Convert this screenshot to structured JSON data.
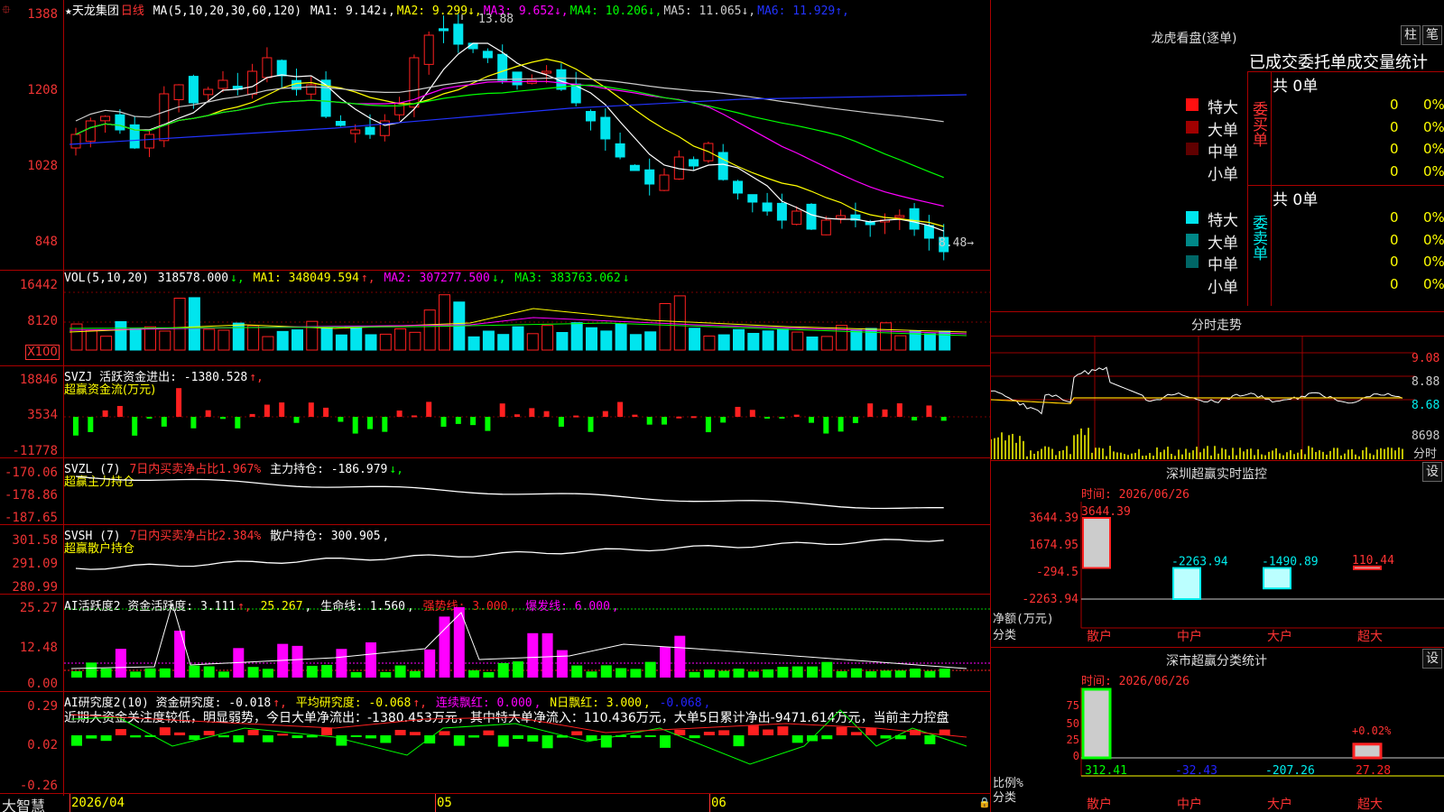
{
  "colors": {
    "up": "#ff2020",
    "down": "#00e5ee",
    "grid": "#9a0000",
    "label": "#ff3333"
  },
  "main": {
    "stock_name": "★天龙集团",
    "period": "日线",
    "ma_header": "MA(5,10,20,30,60,120)",
    "ma_values": [
      {
        "label": "MA1:",
        "value": "9.142",
        "arrow": "↓",
        "color": "#ffffff"
      },
      {
        "label": "MA2:",
        "value": "9.299",
        "arrow": "↓",
        "color": "#ffff00"
      },
      {
        "label": "MA3:",
        "value": "9.652",
        "arrow": "↓",
        "color": "#ff00ff"
      },
      {
        "label": "MA4:",
        "value": "10.206",
        "arrow": "↓",
        "color": "#00ff00"
      },
      {
        "label": "MA5:",
        "value": "11.065",
        "arrow": "↓",
        "color": "#cccccc"
      },
      {
        "label": "MA6:",
        "value": "11.929",
        "arrow": "↑",
        "color": "#2233ff"
      }
    ],
    "y_ticks": [
      "1388",
      "1208",
      "1028",
      "848"
    ],
    "high_mark": "13.88",
    "low_mark": "8.48→"
  },
  "vol": {
    "header": "VOL(5,10,20)",
    "value": "318578.000",
    "ma1": "MA1: 348049.594",
    "ma2": "MA2: 307277.500",
    "ma3": "MA3: 383763.062",
    "y_ticks": [
      "16442",
      "8120"
    ],
    "unit": "X100"
  },
  "svzj": {
    "header": "SVZJ  活跃资金进出: -1380.528",
    "title": "超赢资金流(万元)",
    "y_ticks": [
      "18846",
      "3534",
      "-11778"
    ]
  },
  "svzl": {
    "header1": "SVZL (7)",
    "header2": "7日内买卖净占比1.967%",
    "header3": "主力持仓: -186.979",
    "title": "超赢主力持仓",
    "y_ticks": [
      "-170.06",
      "-178.86",
      "-187.65"
    ]
  },
  "svsh": {
    "header1": "SVSH (7)",
    "header2": "7日内买卖净占比2.384%",
    "header3": "散户持仓: 300.905",
    "title": "超赢散户持仓",
    "y_ticks": [
      "301.58",
      "291.09",
      "280.99"
    ]
  },
  "ai1": {
    "header1": "AI活跃度2 资金活跃度: 3.111",
    "header2": "25.267",
    "header3": "生命线: 1.560",
    "header4": "强势线: 3.000",
    "header5": "爆发线: 6.000",
    "y_ticks": [
      "25.27",
      "12.48",
      "0.00"
    ]
  },
  "ai2": {
    "header1": "AI研究度2(10) 资金研究度: -0.018",
    "header2": "平均研究度: -0.068",
    "header3": "连续飘红: 0.000",
    "header4": "N日飘红: 3.000",
    "header5": "-0.068",
    "commentary": "近期大资金关注度较低，明显弱势，今日大单净流出：-1380.453万元，其中特大单净流入：110.436万元，大单5日累计净出-9471.614万元，当前主力控盘",
    "y_ticks": [
      "0.29",
      "0.02",
      "-0.26"
    ]
  },
  "xaxis": {
    "dates": [
      "2026/04",
      "05",
      "06"
    ],
    "brand": "大智慧"
  },
  "lhb": {
    "title": "龙虎看盘(逐单)",
    "btn_bar": "柱",
    "btn_pen": "笔",
    "subtitle": "已成交委托单成交量统计",
    "buy": {
      "side": "委买单",
      "total": "共 0单",
      "rows": [
        {
          "label": "特大",
          "value": "0",
          "pct": "0%",
          "color": "#ff1010"
        },
        {
          "label": "大单",
          "value": "0",
          "pct": "0%",
          "color": "#a00000"
        },
        {
          "label": "中单",
          "value": "0",
          "pct": "0%",
          "color": "#600000"
        },
        {
          "label": "小单",
          "value": "0",
          "pct": "0%",
          "color": ""
        }
      ]
    },
    "sell": {
      "side": "委卖单",
      "total": "共 0单",
      "rows": [
        {
          "label": "特大",
          "value": "0",
          "pct": "0%",
          "color": "#00e5ee"
        },
        {
          "label": "大单",
          "value": "0",
          "pct": "0%",
          "color": "#008888"
        },
        {
          "label": "中单",
          "value": "0",
          "pct": "0%",
          "color": "#006666"
        },
        {
          "label": "小单",
          "value": "0",
          "pct": "0%",
          "color": ""
        }
      ]
    }
  },
  "intraday": {
    "title": "分时走势",
    "y_ticks": [
      "9.08",
      "8.88",
      "8.68"
    ],
    "vol_label": "8698",
    "tag": "分时"
  },
  "monitor": {
    "title": "深圳超赢实时监控",
    "btn": "设",
    "time": "时间: 2026/06/26",
    "y_ticks": [
      "3644.39",
      "1674.95",
      "-294.5",
      "-2263.94"
    ],
    "unit": "净额(万元)",
    "cat_label": "分类",
    "bars": [
      {
        "cat": "散户",
        "value": 3644.39,
        "label": "3644.39"
      },
      {
        "cat": "中户",
        "value": -2263.94,
        "label": "-2263.94"
      },
      {
        "cat": "大户",
        "value": -1490.89,
        "label": "-1490.89"
      },
      {
        "cat": "超大",
        "value": 110.44,
        "label": "110.44"
      }
    ]
  },
  "classify": {
    "title": "深市超赢分类统计",
    "btn": "设",
    "time": "时间: 2026/06/26",
    "y_ticks": [
      "75",
      "50",
      "25",
      "0"
    ],
    "unit": "比例%",
    "cat_label": "分类",
    "pos_label": "+0.02%",
    "bars": [
      {
        "cat": "散户",
        "value": "312.41",
        "pct": 100
      },
      {
        "cat": "中户",
        "value": "-32.43",
        "pct": 0
      },
      {
        "cat": "大户",
        "value": "-207.26",
        "pct": 0
      },
      {
        "cat": "超大",
        "value": "27.28",
        "pct": 20
      }
    ]
  }
}
